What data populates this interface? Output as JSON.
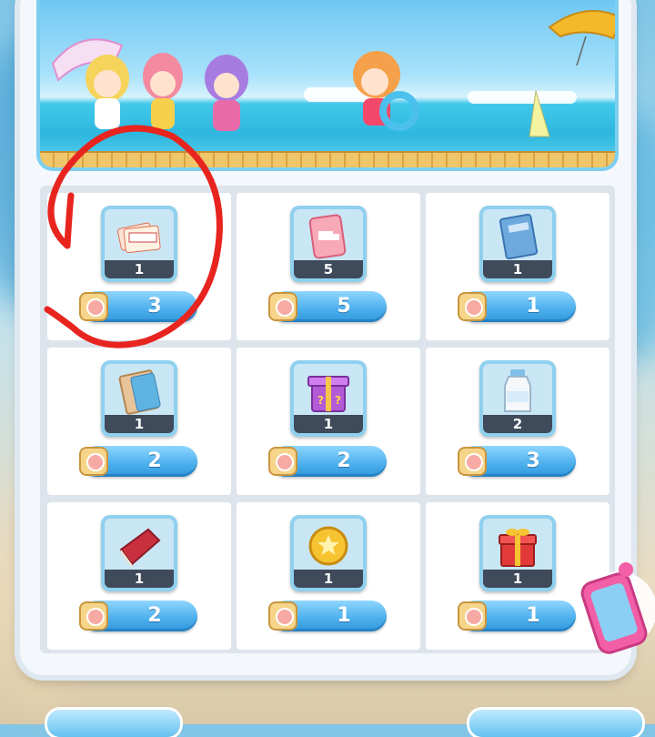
{
  "currency_icon": "character-face-coin-icon",
  "colors": {
    "button_blue": "#4fb2ee",
    "tile_border": "#8fd0ee",
    "count_bar": "#3f4a5a",
    "annotation_red": "#e8241f"
  },
  "banner": {
    "icon": "beach-characters-banner"
  },
  "shop_items": [
    {
      "icon": "2000-ticket-cards-icon",
      "count": "1",
      "price": "3"
    },
    {
      "icon": "delivery-truck-card-icon",
      "count": "5",
      "price": "5"
    },
    {
      "icon": "blue-book-icon",
      "count": "1",
      "price": "1"
    },
    {
      "icon": "orange-blue-book-icon",
      "count": "1",
      "price": "2"
    },
    {
      "icon": "purple-mystery-box-icon",
      "count": "1",
      "price": "2"
    },
    {
      "icon": "milk-bottle-icon",
      "count": "2",
      "price": "3"
    },
    {
      "icon": "red-book-icon",
      "count": "1",
      "price": "2"
    },
    {
      "icon": "gold-star-coin-icon",
      "count": "1",
      "price": "1"
    },
    {
      "icon": "red-gift-box-icon",
      "count": "1",
      "price": "1"
    }
  ],
  "annotation": {
    "icon": "red-hand-drawn-circle"
  },
  "phone_widget": {
    "icon": "pink-phone-icon"
  }
}
